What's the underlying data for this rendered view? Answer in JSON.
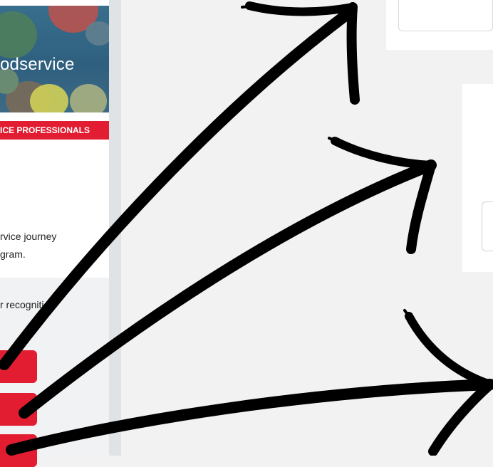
{
  "sidebar": {
    "hero_title": "odservice",
    "ribbon_text": "ICE PROFESSIONALS",
    "description_line_1": "rvice journey",
    "description_line_2": "gram.",
    "recognition_text": "r recognition"
  },
  "colors": {
    "accent": "#e21d31",
    "page_background": "#f2f2f2",
    "arrow": "#000000"
  },
  "overlay": {
    "arrow_count": 3,
    "arrow_icon": "hand-drawn-arrow-icon"
  }
}
